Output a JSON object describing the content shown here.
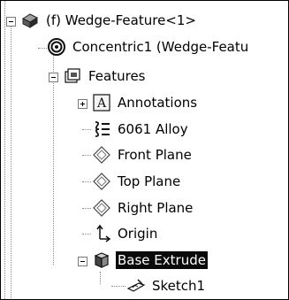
{
  "tree": {
    "root": {
      "label": "(f) Wedge-Feature<1>",
      "icon": "part-icon",
      "expanded": true
    },
    "items": [
      {
        "label": "Concentric1 (Wedge-Featu",
        "icon": "concentric-mate-icon",
        "level": 1,
        "expander": "none"
      },
      {
        "label": "Features",
        "icon": "features-folder-icon",
        "level": 1,
        "expander": "minus"
      },
      {
        "label": "Annotations",
        "icon": "annotations-icon",
        "level": 2,
        "expander": "plus"
      },
      {
        "label": "6061 Alloy",
        "icon": "material-icon",
        "level": 2,
        "expander": "none"
      },
      {
        "label": "Front Plane",
        "icon": "plane-icon",
        "level": 2,
        "expander": "none"
      },
      {
        "label": "Top Plane",
        "icon": "plane-icon",
        "level": 2,
        "expander": "none"
      },
      {
        "label": "Right Plane",
        "icon": "plane-icon",
        "level": 2,
        "expander": "none"
      },
      {
        "label": "Origin",
        "icon": "origin-icon",
        "level": 2,
        "expander": "none"
      },
      {
        "label": "Base Extrude",
        "icon": "extrude-icon",
        "level": 2,
        "expander": "minus",
        "selected": true
      },
      {
        "label": "Sketch1",
        "icon": "sketch-icon",
        "level": 3,
        "expander": "none"
      }
    ]
  },
  "colors": {
    "selection_bg": "#0a0a0a",
    "selection_fg": "#ffffff",
    "tree_line": "#8a8a8a"
  }
}
